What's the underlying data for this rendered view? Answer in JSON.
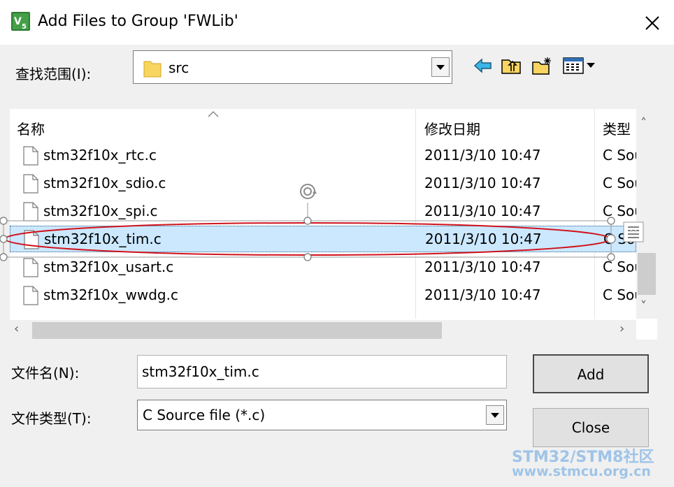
{
  "window": {
    "title": "Add Files to Group 'FWLib'",
    "app_icon": "keil-uv5-icon"
  },
  "look_in": {
    "label": "查找范围(I):",
    "value": "src"
  },
  "toolbar": {
    "icons": [
      "back-arrow-icon",
      "up-folder-icon",
      "new-folder-icon",
      "view-menu-icon"
    ]
  },
  "columns": {
    "name": "名称",
    "date": "修改日期",
    "type": "类型"
  },
  "files": [
    {
      "name": "stm32f10x_rtc.c",
      "date": "2011/3/10 10:47",
      "type": "C Source file"
    },
    {
      "name": "stm32f10x_sdio.c",
      "date": "2011/3/10 10:47",
      "type": "C Source file"
    },
    {
      "name": "stm32f10x_spi.c",
      "date": "2011/3/10 10:47",
      "type": "C Source file"
    },
    {
      "name": "stm32f10x_tim.c",
      "date": "2011/3/10 10:47",
      "type": "C Source file"
    },
    {
      "name": "stm32f10x_usart.c",
      "date": "2011/3/10 10:47",
      "type": "C Source file"
    },
    {
      "name": "stm32f10x_wwdg.c",
      "date": "2011/3/10 10:47",
      "type": "C Source file"
    }
  ],
  "selected_file": "stm32f10x_tim.c",
  "filename": {
    "label": "文件名(N):",
    "value": "stm32f10x_tim.c"
  },
  "filetype": {
    "label": "文件类型(T):",
    "value": "C Source file (*.c)"
  },
  "buttons": {
    "add": "Add",
    "close": "Close"
  },
  "watermark": {
    "line1": "STM32/STM8社区",
    "line2": "www.stmcu.org.cn"
  },
  "colors": {
    "selection": "#cce8ff",
    "annotation_ellipse": "#d0121b",
    "watermark": "#9ec4e8"
  }
}
